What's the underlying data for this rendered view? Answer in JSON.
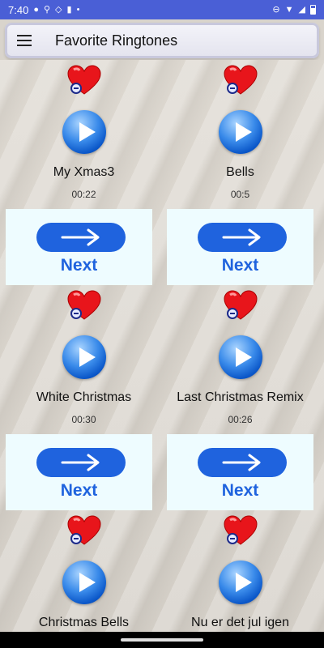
{
  "status_bar": {
    "time": "7:40"
  },
  "toolbar": {
    "title": "Favorite Ringtones",
    "menu_icon": "hamburger-icon"
  },
  "ringtones": [
    {
      "name": "My Xmas3",
      "duration": "00:22"
    },
    {
      "name": "Bells",
      "duration": "00:5"
    },
    {
      "name": "White Christmas",
      "duration": "00:30"
    },
    {
      "name": "Last Christmas Remix",
      "duration": "00:26"
    },
    {
      "name": "Christmas Bells",
      "duration": ""
    },
    {
      "name": "Nu er det jul igen",
      "duration": ""
    }
  ],
  "ad": {
    "label": "Next",
    "icon": "arrow-right-icon"
  },
  "colors": {
    "status_bar": "#4a5fd6",
    "heart": "#e8151b",
    "ad_blue": "#1f63de"
  }
}
